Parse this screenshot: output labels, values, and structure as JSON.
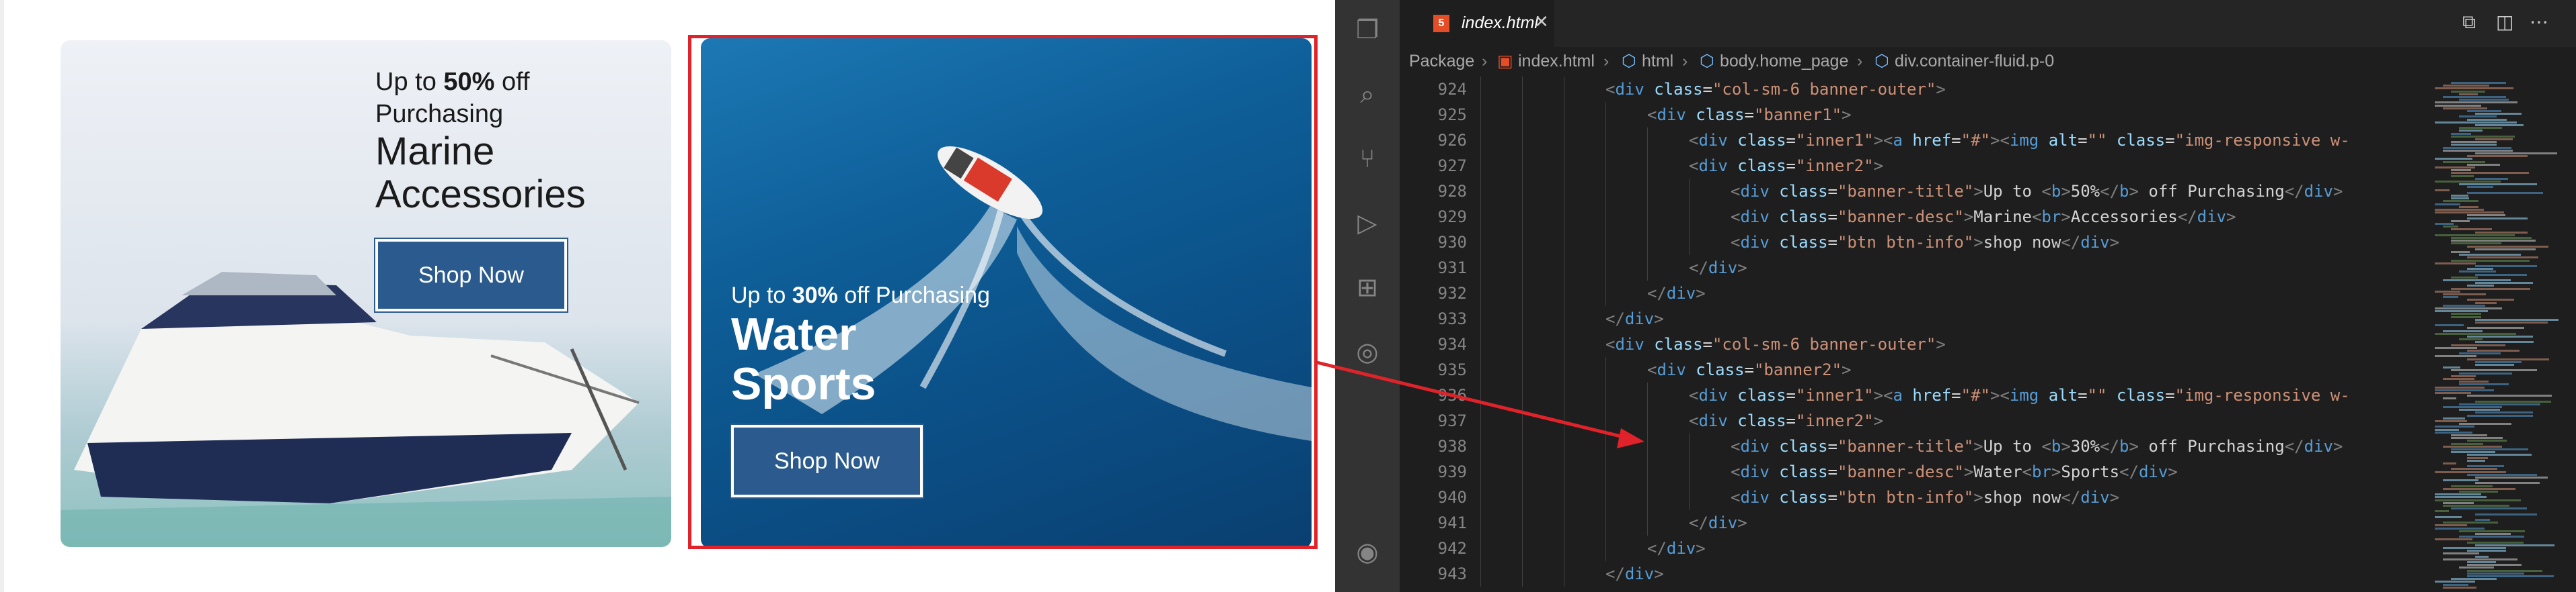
{
  "webpage": {
    "banner1": {
      "title_prefix": "Up to ",
      "title_pct": "50%",
      "title_suffix": " off",
      "title_line2": "Purchasing",
      "desc_line1": "Marine",
      "desc_line2": "Accessories",
      "button": "Shop Now"
    },
    "banner2": {
      "title_prefix": "Up to ",
      "title_pct": "30%",
      "title_suffix": " off Purchasing",
      "desc_line1": "Water",
      "desc_line2": "Sports",
      "button": "Shop Now"
    }
  },
  "vscode": {
    "tab": {
      "label": "index.html"
    },
    "breadcrumb": [
      "Package",
      "index.html",
      "html",
      "body.home_page",
      "div.container-fluid.p-0"
    ],
    "lines": [
      {
        "n": "924",
        "ind": 3,
        "c": "<div class=\"col-sm-6 banner-outer\">"
      },
      {
        "n": "925",
        "ind": 4,
        "c": "<div class=\"banner1\">"
      },
      {
        "n": "926",
        "ind": 5,
        "c": "<div class=\"inner1\"><a href=\"#\"><img alt=\"\" class=\"img-responsive w-"
      },
      {
        "n": "927",
        "ind": 5,
        "c": "<div class=\"inner2\">"
      },
      {
        "n": "928",
        "ind": 6,
        "c": "<div class=\"banner-title\">Up to <b>50%</b> off Purchasing</div>"
      },
      {
        "n": "929",
        "ind": 6,
        "c": "<div class=\"banner-desc\">Marine<br>Accessories</div>"
      },
      {
        "n": "930",
        "ind": 6,
        "c": "<div class=\"btn btn-info\">shop now</div>"
      },
      {
        "n": "931",
        "ind": 5,
        "c": "</div>"
      },
      {
        "n": "932",
        "ind": 4,
        "c": "</div>"
      },
      {
        "n": "933",
        "ind": 3,
        "c": "</div>"
      },
      {
        "n": "934",
        "ind": 3,
        "c": "<div class=\"col-sm-6 banner-outer\">"
      },
      {
        "n": "935",
        "ind": 4,
        "c": "<div class=\"banner2\">"
      },
      {
        "n": "936",
        "ind": 5,
        "c": "<div class=\"inner1\"><a href=\"#\"><img alt=\"\" class=\"img-responsive w-"
      },
      {
        "n": "937",
        "ind": 5,
        "c": "<div class=\"inner2\">"
      },
      {
        "n": "938",
        "ind": 6,
        "c": "<div class=\"banner-title\">Up to <b>30%</b> off Purchasing</div>"
      },
      {
        "n": "939",
        "ind": 6,
        "c": "<div class=\"banner-desc\">Water<br>Sports</div>"
      },
      {
        "n": "940",
        "ind": 6,
        "c": "<div class=\"btn btn-info\">shop now</div>"
      },
      {
        "n": "941",
        "ind": 5,
        "c": "</div>"
      },
      {
        "n": "942",
        "ind": 4,
        "c": "</div>"
      },
      {
        "n": "943",
        "ind": 3,
        "c": "</div>"
      }
    ]
  },
  "colors": {
    "highlight": "#e0232a",
    "button": "#2b5b8e",
    "editor_bg": "#1e1e1e"
  }
}
